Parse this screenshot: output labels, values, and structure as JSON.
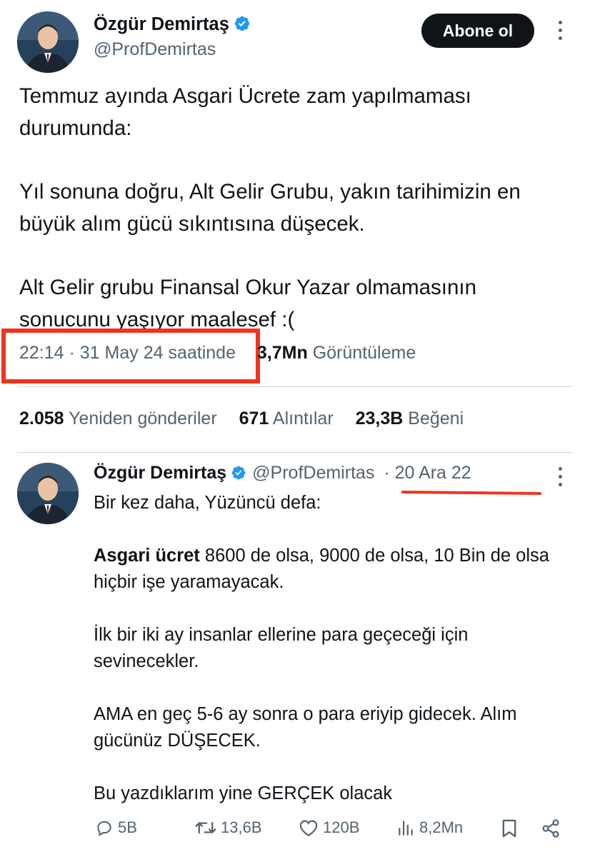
{
  "tweet": {
    "author": {
      "name": "Özgür Demirtaş",
      "handle": "@ProfDemirtas"
    },
    "follow_label": "Abone ol",
    "text": {
      "para1": "Temmuz ayında Asgari Ücrete zam yapılmaması durumunda:",
      "para2": "Yıl sonuna doğru, Alt Gelir Grubu, yakın tarihimizin en büyük alım gücü sıkıntısına düşecek.",
      "para3": "Alt Gelir grubu Finansal Okur Yazar olmamasının sonucunu yaşıyor maalesef :("
    },
    "timestamp": "22:14 · 31 May 24 saatinde",
    "views_count": "3,7Mn",
    "views_label": "Görüntüleme",
    "stats": {
      "reposts_count": "2.058",
      "reposts_label": "Yeniden gönderiler",
      "quotes_count": "671",
      "quotes_label": "Alıntılar",
      "likes_count": "23,3B",
      "likes_label": "Beğeni"
    }
  },
  "quoted": {
    "author": {
      "name": "Özgür Demirtaş",
      "handle": "@ProfDemirtas",
      "date": "· 20 Ara 22"
    },
    "text": {
      "line1": "Bir kez daha, Yüzüncü defa:",
      "bold_lead": "Asgari ücret",
      "para2_rest": " 8600 de olsa, 9000 de olsa, 10 Bin de olsa hiçbir işe yaramayacak.",
      "para3": "İlk bir iki ay insanlar ellerine para geçeceği için sevinecekler.",
      "para4": "AMA en geç 5-6 ay sonra o para eriyip gidecek. Alım gücünüz DÜŞECEK.",
      "para5": "Bu yazdıklarım yine GERÇEK olacak"
    },
    "actions": {
      "replies": "5B",
      "reposts": "13,6B",
      "likes": "120B",
      "views": "8,2Mn"
    }
  },
  "colors": {
    "accent_blue": "#1d9bf0",
    "highlight_red": "#f0351f",
    "text_secondary": "#536471"
  },
  "icons": [
    "verified-badge-icon",
    "more-options-icon",
    "reply-icon",
    "repost-icon",
    "like-icon",
    "views-icon",
    "bookmark-icon",
    "share-icon"
  ]
}
